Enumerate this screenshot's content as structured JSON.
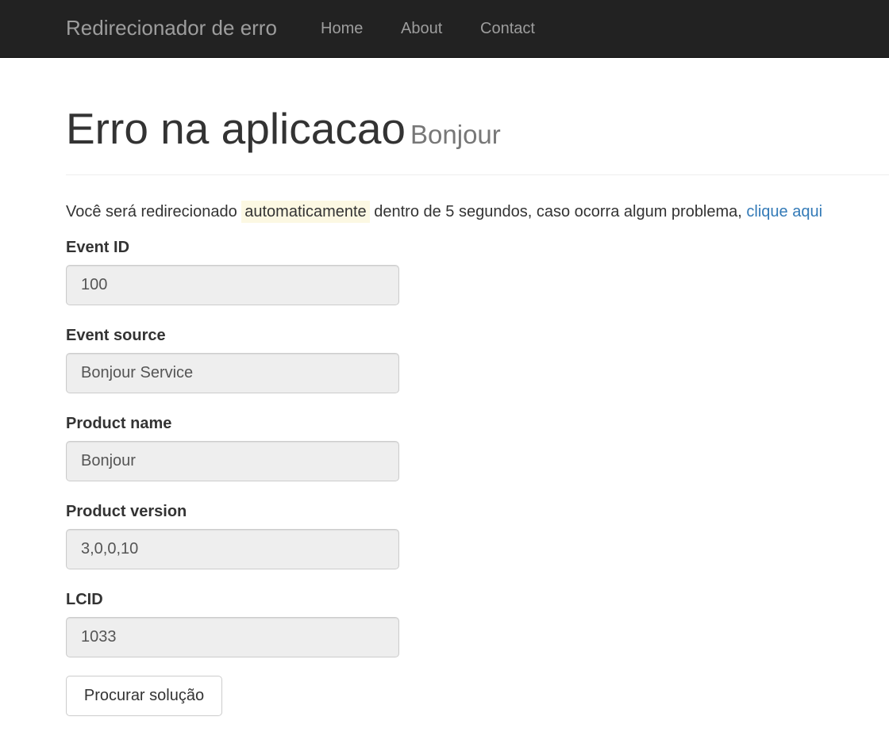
{
  "navbar": {
    "brand": "Redirecionador de erro",
    "links": [
      "Home",
      "About",
      "Contact"
    ]
  },
  "header": {
    "title": "Erro na aplicacao",
    "subtitle": "Bonjour"
  },
  "message": {
    "before": "Você será redirecionado ",
    "highlight": "automaticamente",
    "after": " dentro de 5 segundos, caso ocorra algum problema, ",
    "link": "clique aqui"
  },
  "fields": [
    {
      "label": "Event ID",
      "value": "100"
    },
    {
      "label": "Event source",
      "value": "Bonjour Service"
    },
    {
      "label": "Product name",
      "value": "Bonjour"
    },
    {
      "label": "Product version",
      "value": "3,0,0,10"
    },
    {
      "label": "LCID",
      "value": "1033"
    }
  ],
  "button": {
    "label": "Procurar solução"
  },
  "colors": {
    "navbar_bg": "#222222",
    "nav_text": "#9d9d9d",
    "link": "#337ab7",
    "highlight_bg": "#fcf8e3",
    "input_bg": "#eeeeee"
  }
}
